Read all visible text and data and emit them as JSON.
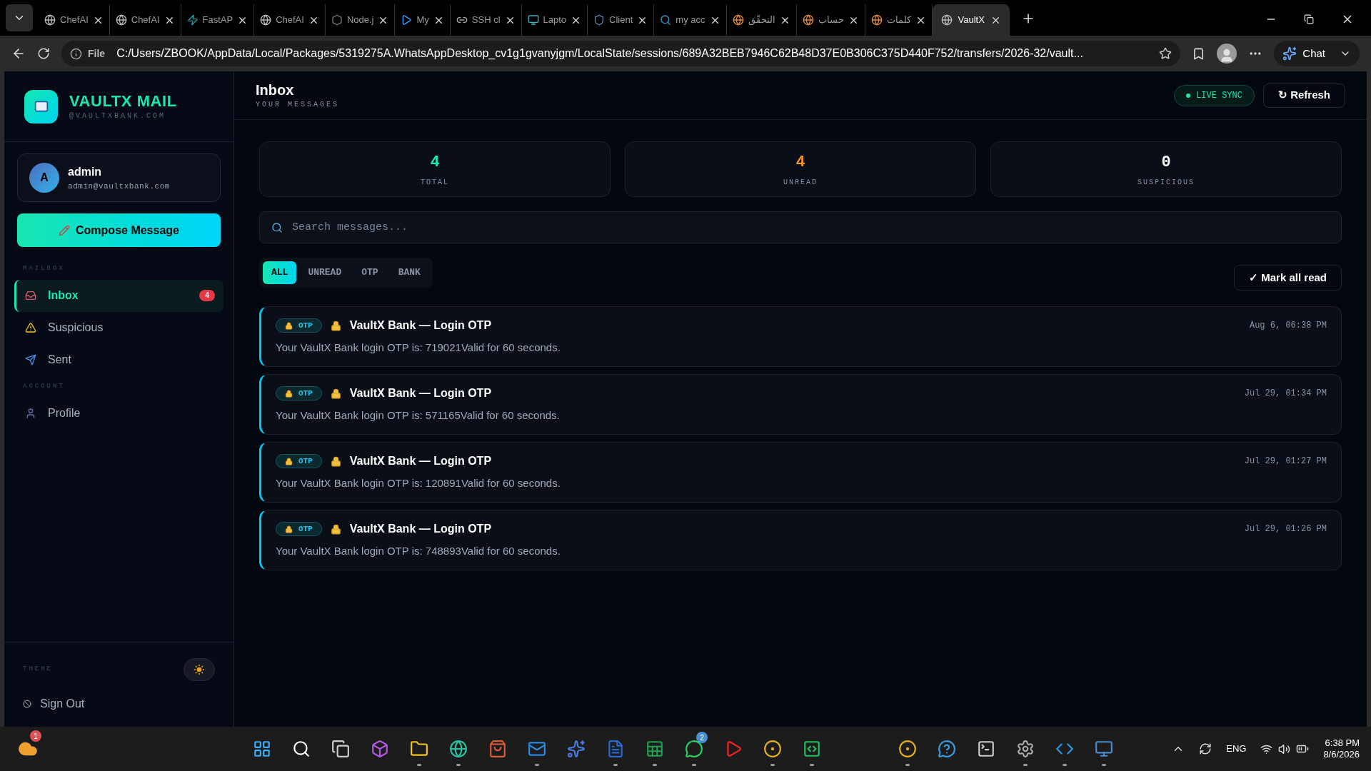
{
  "browser": {
    "tabs": [
      {
        "label": "ChefAI",
        "kind": "globe",
        "selected": false
      },
      {
        "label": "ChefAI",
        "kind": "globe",
        "selected": false
      },
      {
        "label": "FastAP",
        "kind": "bolt",
        "selected": false
      },
      {
        "label": "ChefAI",
        "kind": "globe",
        "selected": false
      },
      {
        "label": "Node.j",
        "kind": "hex",
        "selected": false
      },
      {
        "label": "My",
        "kind": "play",
        "selected": false
      },
      {
        "label": "SSH cl",
        "kind": "link",
        "selected": false
      },
      {
        "label": "Lapto",
        "kind": "monitor",
        "selected": false
      },
      {
        "label": "Client",
        "kind": "shield",
        "selected": false
      },
      {
        "label": "my acc",
        "kind": "search",
        "selected": false
      },
      {
        "label": "التحقّق",
        "kind": "g",
        "selected": false
      },
      {
        "label": "حساب",
        "kind": "g",
        "selected": false
      },
      {
        "label": "كلمات",
        "kind": "g",
        "selected": false
      },
      {
        "label": "VaultX",
        "kind": "globe",
        "selected": true
      }
    ],
    "address": {
      "scheme": "File",
      "url": "C:/Users/ZBOOK/AppData/Local/Packages/5319275A.WhatsAppDesktop_cv1g1gvanyjgm/LocalState/sessions/689A32BEB7946C62B48D37E0B306C375D440F752/transfers/2026-32/vault..."
    },
    "chat_label": "Chat"
  },
  "sidebar": {
    "brand": {
      "title": "VAULTX MAIL",
      "subtitle": "@VAULTXBANK.COM"
    },
    "user": {
      "initial": "A",
      "name": "admin",
      "email": "admin@vaultxbank.com"
    },
    "compose": "Compose Message",
    "sections": [
      {
        "heading": "MAILBOX",
        "items": [
          {
            "label": "Inbox",
            "kind": "inbox",
            "selected": true,
            "badge": "4"
          },
          {
            "label": "Suspicious",
            "kind": "warning",
            "selected": false
          },
          {
            "label": "Sent",
            "kind": "sent",
            "selected": false
          }
        ]
      },
      {
        "heading": "ACCOUNT",
        "items": [
          {
            "label": "Profile",
            "kind": "user",
            "selected": false
          }
        ]
      }
    ],
    "theme": {
      "label": "THEME"
    },
    "sign_out": "Sign Out"
  },
  "header": {
    "title": "Inbox",
    "subtitle": "YOUR MESSAGES",
    "live": "LIVE SYNC",
    "refresh": "↻ Refresh"
  },
  "stats": [
    {
      "value": "4",
      "label": "TOTAL",
      "color": "#19e6b0"
    },
    {
      "value": "4",
      "label": "UNREAD",
      "color": "#f0932b"
    },
    {
      "value": "0",
      "label": "SUSPICIOUS",
      "color": "#ffffff"
    }
  ],
  "search": {
    "placeholder": "Search messages..."
  },
  "filters": [
    {
      "label": "ALL",
      "selected": true
    },
    {
      "label": "UNREAD",
      "selected": false
    },
    {
      "label": "OTP",
      "selected": false
    },
    {
      "label": "BANK",
      "selected": false
    }
  ],
  "mark_all": "✓ Mark all read",
  "messages": [
    {
      "tag": "OTP",
      "subject": "VaultX Bank — Login OTP",
      "preview": "Your VaultX Bank login OTP is: 719021Valid for 60 seconds.",
      "time": "Aug 6, 06:38 PM",
      "unread": true
    },
    {
      "tag": "OTP",
      "subject": "VaultX Bank — Login OTP",
      "preview": "Your VaultX Bank login OTP is: 571165Valid for 60 seconds.",
      "time": "Jul 29, 01:34 PM",
      "unread": true
    },
    {
      "tag": "OTP",
      "subject": "VaultX Bank — Login OTP",
      "preview": "Your VaultX Bank login OTP is: 120891Valid for 60 seconds.",
      "time": "Jul 29, 01:27 PM",
      "unread": true
    },
    {
      "tag": "OTP",
      "subject": "VaultX Bank — Login OTP",
      "preview": "Your VaultX Bank login OTP is: 748893Valid for 60 seconds.",
      "time": "Jul 29, 01:26 PM",
      "unread": true
    }
  ],
  "taskbar": {
    "weather": {
      "badge": "1"
    },
    "apps": [
      {
        "kind": "start",
        "running": false
      },
      {
        "kind": "search",
        "running": false
      },
      {
        "kind": "taskview",
        "running": false
      },
      {
        "kind": "office",
        "running": false
      },
      {
        "kind": "folder",
        "running": true
      },
      {
        "kind": "edge",
        "running": true
      },
      {
        "kind": "store",
        "running": false
      },
      {
        "kind": "mail",
        "running": true
      },
      {
        "kind": "copilot",
        "running": false
      },
      {
        "kind": "word",
        "running": true
      },
      {
        "kind": "excel",
        "running": true
      },
      {
        "kind": "chat",
        "running": true,
        "badge": "2"
      },
      {
        "kind": "video",
        "running": false
      },
      {
        "kind": "chrome",
        "running": true
      },
      {
        "kind": "ide",
        "running": true
      }
    ],
    "apps_right": [
      {
        "kind": "chrome",
        "running": true
      },
      {
        "kind": "help",
        "running": false
      },
      {
        "kind": "terminal",
        "running": false
      },
      {
        "kind": "settings",
        "running": true
      },
      {
        "kind": "code",
        "running": true
      },
      {
        "kind": "python",
        "running": true
      }
    ],
    "tray": {
      "language": "ENG",
      "time": "6:38 PM",
      "date": "8/6/2026"
    }
  }
}
